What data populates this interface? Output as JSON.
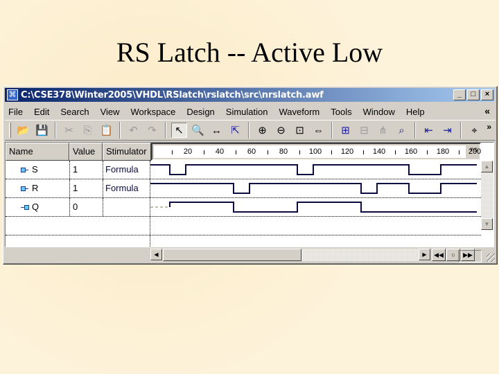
{
  "slide": {
    "title": "RS Latch  -- Active Low"
  },
  "window": {
    "title": "C:\\CSE378\\Winter2005\\VHDL\\RSlatch\\rslatch\\src\\nrslatch.awf",
    "buttons": {
      "minimize": "_",
      "maximize": "□",
      "close": "×"
    }
  },
  "menu": {
    "items": [
      "File",
      "Edit",
      "Search",
      "View",
      "Workspace",
      "Design",
      "Simulation",
      "Waveform",
      "Tools",
      "Window",
      "Help"
    ],
    "overflow": "«"
  },
  "toolbar": {
    "groups": [
      [
        {
          "name": "open-icon",
          "glyph": "📂"
        },
        {
          "name": "save-icon",
          "glyph": "💾"
        }
      ],
      [
        {
          "name": "cut-icon",
          "glyph": "✂",
          "disabled": true
        },
        {
          "name": "copy-icon",
          "glyph": "⎘",
          "disabled": true
        },
        {
          "name": "paste-icon",
          "glyph": "📋",
          "disabled": true
        }
      ],
      [
        {
          "name": "undo-icon",
          "glyph": "↶",
          "disabled": true
        },
        {
          "name": "redo-icon",
          "glyph": "↷",
          "disabled": true
        }
      ],
      [
        {
          "name": "select-pointer-icon",
          "glyph": "↖",
          "pressed": true
        },
        {
          "name": "zoom-tool-icon",
          "glyph": "🔍"
        },
        {
          "name": "measure-icon",
          "glyph": "↔"
        },
        {
          "name": "select-signal-icon",
          "glyph": "⇱"
        }
      ],
      [
        {
          "name": "zoom-in-icon",
          "glyph": "⊕"
        },
        {
          "name": "zoom-out-icon",
          "glyph": "⊖"
        },
        {
          "name": "zoom-range-icon",
          "glyph": "⊡"
        },
        {
          "name": "zoom-fit-icon",
          "glyph": "⇔"
        }
      ],
      [
        {
          "name": "add-signal-icon",
          "glyph": "⊞"
        },
        {
          "name": "remove-signal-icon",
          "glyph": "⊟",
          "disabled": true
        },
        {
          "name": "bus-icon",
          "glyph": "⋔",
          "disabled": true
        },
        {
          "name": "find-signal-icon",
          "glyph": "⌕"
        }
      ],
      [
        {
          "name": "prev-edge-icon",
          "glyph": "⇤"
        },
        {
          "name": "next-edge-icon",
          "glyph": "⇥"
        }
      ],
      [
        {
          "name": "find-binoculars-icon",
          "glyph": "⌖"
        }
      ]
    ],
    "overflow": "»"
  },
  "waveform": {
    "headers": {
      "name": "Name",
      "value": "Value",
      "stimulator": "Stimulator"
    },
    "ruler": {
      "ticks": [
        "20",
        "40",
        "60",
        "80",
        "100",
        "120",
        "140",
        "160",
        "180",
        "200"
      ],
      "unit": "ns"
    },
    "signals": [
      {
        "name": "S",
        "value": "1",
        "stimulator": "Formula",
        "kind": "input",
        "initial": 1,
        "unknown_until": null,
        "edges": [
          10,
          20,
          90,
          100,
          160,
          180
        ]
      },
      {
        "name": "R",
        "value": "1",
        "stimulator": "Formula",
        "kind": "input",
        "initial": 1,
        "unknown_until": null,
        "edges": [
          50,
          60,
          130,
          140,
          160,
          180
        ]
      },
      {
        "name": "Q",
        "value": "0",
        "stimulator": "",
        "kind": "output",
        "initial": 1,
        "unknown_until": 10,
        "edges": [
          50,
          90,
          130
        ]
      }
    ],
    "time_range_ns": [
      0,
      200
    ]
  },
  "colors": {
    "wave": "#0a0a40",
    "unknown": "#808060",
    "title_gradient_start": "#0a246a",
    "title_gradient_end": "#a6caf0"
  }
}
